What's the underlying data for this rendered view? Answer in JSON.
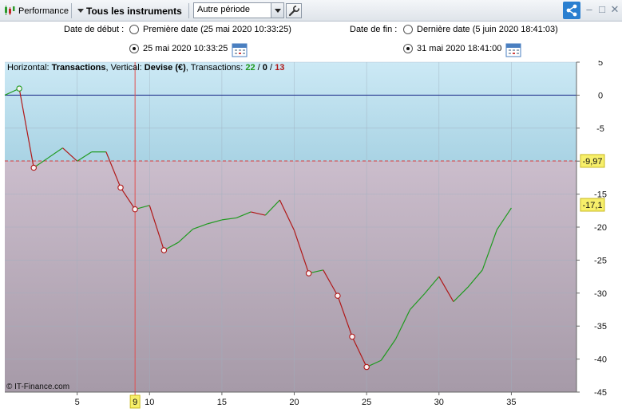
{
  "toolbar": {
    "performance_label": "Performance",
    "instruments_label": "Tous les instruments",
    "period_value": "Autre période",
    "icons": [
      "performance-icon",
      "dropdown-arrow-icon",
      "wrench-icon",
      "share-icon",
      "minimize-icon",
      "maximize-icon",
      "close-icon"
    ]
  },
  "dates": {
    "start_label": "Date de début :",
    "start_first_option": "Première date (25 mai 2020 10:33:25)",
    "start_custom_value": "25 mai 2020 10:33:25",
    "start_selected": "custom",
    "end_label": "Date de fin :",
    "end_last_option": "Dernière date (5 juin 2020 18:41:03)",
    "end_custom_value": "31 mai 2020 18:41:00",
    "end_selected": "custom"
  },
  "chart_info": {
    "horizontal_prefix": "Horizontal: ",
    "horizontal_value": "Transactions",
    "vertical_prefix": ", Vertical: ",
    "vertical_value": "Devise (€)",
    "transactions_prefix": ", Transactions: ",
    "wins": "22",
    "slash1": " / ",
    "neutral": "0",
    "slash2": " / ",
    "losses": "13"
  },
  "footer": {
    "copyright": "© IT-Finance.com"
  },
  "colors": {
    "gain": "#1f9a1f",
    "loss": "#b01818",
    "zone_above": "#c9e7f3",
    "zone_below": "#c5b4c4",
    "marker_bg": "#f7ef6a"
  },
  "chart_data": {
    "type": "line",
    "title": "",
    "xlabel": "Transactions",
    "ylabel": "Devise (€)",
    "x": [
      0,
      1,
      2,
      3,
      4,
      5,
      6,
      7,
      8,
      9,
      10,
      11,
      12,
      13,
      14,
      15,
      16,
      17,
      18,
      19,
      20,
      21,
      22,
      23,
      24,
      25,
      26,
      27,
      28,
      29,
      30,
      31,
      32,
      33,
      34,
      35
    ],
    "y": [
      0,
      1,
      -11,
      -9.5,
      -8,
      -10,
      -8.6,
      -8.6,
      -14,
      -17.3,
      -16.7,
      -23.5,
      -22.3,
      -20.3,
      -19.5,
      -18.9,
      -18.6,
      -17.7,
      -18.2,
      -15.9,
      -20.5,
      -27,
      -26.5,
      -30.4,
      -36.6,
      -41.2,
      -40.2,
      -37,
      -32.5,
      -30.1,
      -27.5,
      -31.3,
      -29.1,
      -26.5,
      -20.4,
      -17.1
    ],
    "win_loss": [
      "",
      "w",
      "l",
      "w",
      "w",
      "l",
      "w",
      "w",
      "l",
      "l",
      "w",
      "l",
      "w",
      "w",
      "w",
      "w",
      "w",
      "w",
      "l",
      "w",
      "l",
      "l",
      "w",
      "l",
      "l",
      "l",
      "w",
      "w",
      "w",
      "w",
      "w",
      "l",
      "w",
      "w",
      "w",
      "w"
    ],
    "x_ticks": [
      5,
      10,
      15,
      20,
      25,
      30,
      35
    ],
    "y_ticks": [
      5,
      0,
      -5,
      -10,
      -15,
      -20,
      -25,
      -30,
      -35,
      -40,
      -45
    ],
    "y_tick_labels": [
      "5",
      "0",
      "-5",
      "",
      "-15",
      "-20",
      "-25",
      "-30",
      "-35",
      "-40",
      "-45"
    ],
    "xlim": [
      0,
      39.5
    ],
    "ylim": [
      -45,
      5
    ],
    "reference_line": {
      "value": -9.97,
      "label": "-9,97"
    },
    "zero_line": 0,
    "cursor": {
      "x": 9,
      "x_label": "9",
      "y_label": "-17,1"
    },
    "grid": true
  }
}
